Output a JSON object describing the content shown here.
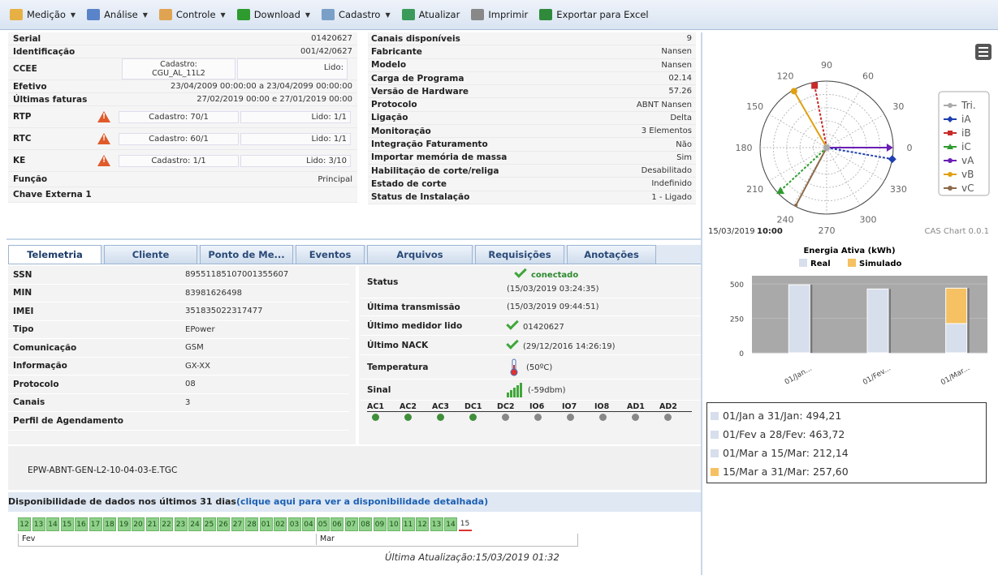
{
  "toolbar": {
    "items": [
      {
        "label": "Medição",
        "dropdown": true,
        "icon": "measure-icon",
        "color": "#e6b044"
      },
      {
        "label": "Análise",
        "dropdown": true,
        "icon": "analysis-icon",
        "color": "#5a84c9"
      },
      {
        "label": "Controle",
        "dropdown": true,
        "icon": "control-icon",
        "color": "#e0a352"
      },
      {
        "label": "Download",
        "dropdown": true,
        "icon": "download-icon",
        "color": "#2e9b2e"
      },
      {
        "label": "Cadastro",
        "dropdown": true,
        "icon": "register-icon",
        "color": "#7aa0c8"
      },
      {
        "label": "Atualizar",
        "dropdown": false,
        "icon": "refresh-icon",
        "color": "#3a9a5a"
      },
      {
        "label": "Imprimir",
        "dropdown": false,
        "icon": "print-icon",
        "color": "#888888"
      },
      {
        "label": "Exportar para Excel",
        "dropdown": false,
        "icon": "excel-icon",
        "color": "#2f8a3b"
      }
    ]
  },
  "meter_info": {
    "serial": {
      "label": "Serial",
      "value": "01420627"
    },
    "identificacao": {
      "label": "Identificação",
      "value": "001/42/0627"
    },
    "ccee": {
      "label": "CCEE",
      "cadastro": "Cadastro:\nCGU_AL_11L2",
      "lido": "Lido:"
    },
    "efetivo": {
      "label": "Efetivo",
      "value": "23/04/2009 00:00:00 a 23/04/2099 00:00:00"
    },
    "ultimas_faturas": {
      "label": "Últimas faturas",
      "value": "27/02/2019 00:00 e 27/01/2019 00:00"
    },
    "rtp": {
      "label": "RTP",
      "cadastro": "Cadastro: 70/1",
      "lido": "Lido: 1/1"
    },
    "rtc": {
      "label": "RTC",
      "cadastro": "Cadastro: 60/1",
      "lido": "Lido: 1/1"
    },
    "ke": {
      "label": "KE",
      "cadastro": "Cadastro: 1/1",
      "lido": "Lido: 3/10"
    },
    "funcao": {
      "label": "Função",
      "value": "Principal"
    },
    "chave_externa": {
      "label": "Chave Externa 1",
      "value": ""
    }
  },
  "meter_details": [
    {
      "label": "Canais disponíveis",
      "value": "9"
    },
    {
      "label": "Fabricante",
      "value": "Nansen"
    },
    {
      "label": "Modelo",
      "value": "Nansen"
    },
    {
      "label": "Carga de Programa",
      "value": "02.14"
    },
    {
      "label": "Versão de Hardware",
      "value": "57.26"
    },
    {
      "label": "Protocolo",
      "value": "ABNT Nansen"
    },
    {
      "label": "Ligação",
      "value": "Delta"
    },
    {
      "label": "Monitoração",
      "value": "3 Elementos"
    },
    {
      "label": "Integração Faturamento",
      "value": "Não"
    },
    {
      "label": "Importar memória de massa",
      "value": "Sim"
    },
    {
      "label": "Habilitação de corte/religa",
      "value": "Desabilitado"
    },
    {
      "label": "Estado de corte",
      "value": "Indefinido"
    },
    {
      "label": "Status de Instalação",
      "value": "1 - Ligado"
    }
  ],
  "polar_chart": {
    "angle_labels": [
      "90",
      "60",
      "30",
      "0",
      "330",
      "300",
      "270",
      "240",
      "210",
      "180",
      "150",
      "120"
    ],
    "legend": [
      "Tri.",
      "iA",
      "iB",
      "iC",
      "vA",
      "vB",
      "vC"
    ],
    "timestamp_date": "15/03/2019",
    "timestamp_time": "10:00",
    "credit": "CAS Chart 0.0.1",
    "menu_icon": "hamburger-menu-icon"
  },
  "tabs": [
    "Telemetria",
    "Cliente",
    "Ponto de Me...",
    "Eventos",
    "Arquivos",
    "Requisições",
    "Anotações"
  ],
  "telemetry": [
    {
      "label": "SSN",
      "value": "89551185107001355607"
    },
    {
      "label": "MIN",
      "value": "83981626498"
    },
    {
      "label": "IMEI",
      "value": "351835022317477"
    },
    {
      "label": "Tipo",
      "value": "EPower"
    },
    {
      "label": "Comunicação",
      "value": "GSM"
    },
    {
      "label": "Informação",
      "value": "GX-XX"
    },
    {
      "label": "Protocolo",
      "value": "08"
    },
    {
      "label": "Canais",
      "value": "3"
    },
    {
      "label": "Perfil de Agendamento",
      "value": ""
    }
  ],
  "status": {
    "status_label": "Status",
    "status_value": "conectado",
    "status_time": "(15/03/2019 03:24:35)",
    "ultima_transmissao_label": "Última transmissão",
    "ultima_transmissao": "(15/03/2019 09:44:51)",
    "ultimo_medidor_label": "Último medidor lido",
    "ultimo_medidor": "01420627",
    "ultimo_nack_label": "Último NACK",
    "ultimo_nack": "(29/12/2016 14:26:19)",
    "temperatura_label": "Temperatura",
    "temperatura": "(50ºC)",
    "sinal_label": "Sinal",
    "sinal": "(-59dbm)",
    "io_channels": [
      "AC1",
      "AC2",
      "AC3",
      "DC1",
      "DC2",
      "IO6",
      "IO7",
      "IO8",
      "AD1",
      "AD2"
    ]
  },
  "firmware_file": "EPW-ABNT-GEN-L2-10-04-03-E.TGC",
  "availability": {
    "title": "Disponibilidade de dados nos últimos 31 dias",
    "link": "(clique aqui para ver a disponibilidade detalhada)",
    "days": [
      "12",
      "13",
      "14",
      "15",
      "16",
      "17",
      "18",
      "19",
      "20",
      "21",
      "22",
      "23",
      "24",
      "25",
      "26",
      "27",
      "28",
      "01",
      "02",
      "03",
      "04",
      "05",
      "06",
      "07",
      "08",
      "09",
      "10",
      "11",
      "12",
      "13",
      "14",
      "15"
    ],
    "month_fev": "Fev",
    "month_mar": "Mar",
    "last_update": "Última Atualização:15/03/2019 01:32"
  },
  "chart_data": {
    "type": "bar",
    "title": "Energia Ativa (kWh)",
    "categories": [
      "01/Jan...",
      "01/Fev...",
      "01/Mar..."
    ],
    "series": [
      {
        "name": "Real",
        "values": [
          494.21,
          463.72,
          212.14
        ]
      },
      {
        "name": "Simulado",
        "values": [
          0,
          0,
          257.6
        ]
      }
    ],
    "yticks": [
      "500",
      "250",
      "0"
    ],
    "ylim": [
      0,
      560
    ],
    "colors": {
      "Real": "#d7deec",
      "Simulado": "#f5c162"
    },
    "legend_position": "top"
  },
  "energy_summary": [
    {
      "text": "01/Jan a 31/Jan: 494,21",
      "color": "#d7deec"
    },
    {
      "text": "01/Fev a 28/Fev: 463,72",
      "color": "#d7deec"
    },
    {
      "text": "01/Mar a 15/Mar: 212,14",
      "color": "#d7deec"
    },
    {
      "text": "15/Mar a 31/Mar: 257,60",
      "color": "#f5c162"
    }
  ]
}
